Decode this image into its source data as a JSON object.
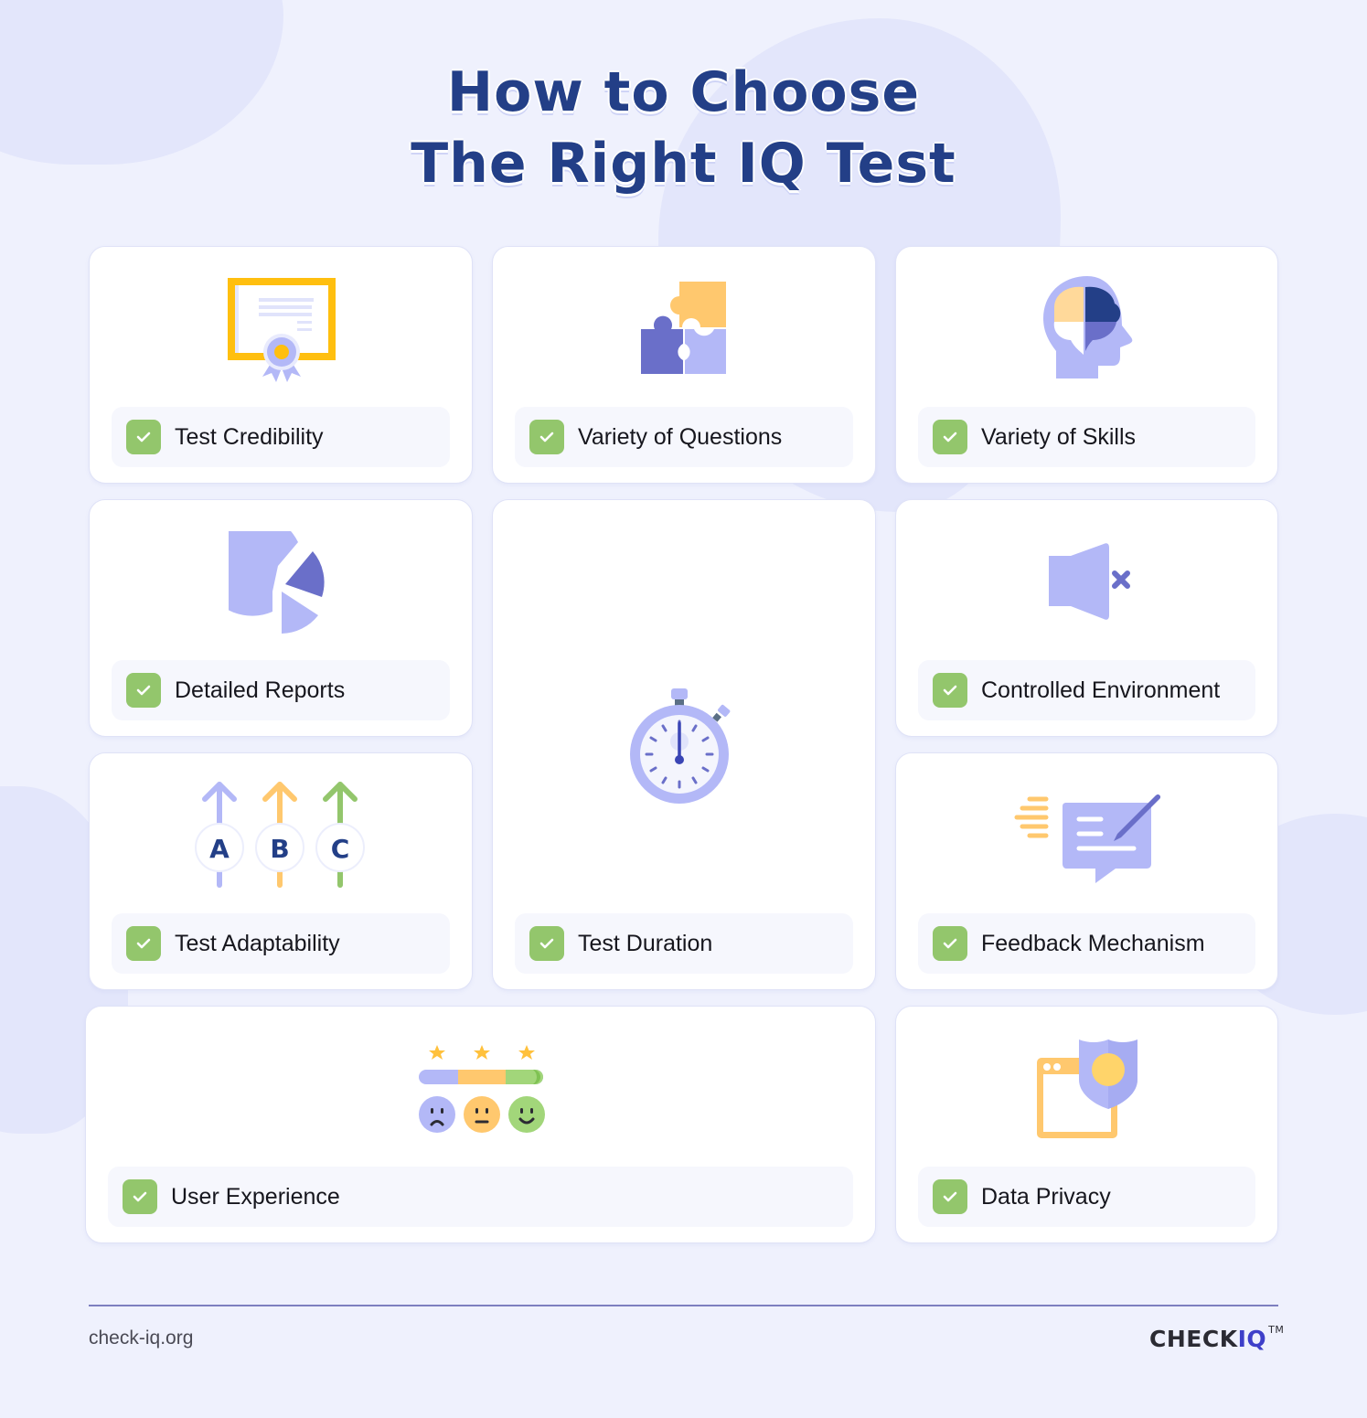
{
  "header": {
    "title_line1": "How to Choose",
    "title_line2": "The Right IQ Test"
  },
  "cards": [
    {
      "label": "Test Credibility",
      "icon": "certificate-icon"
    },
    {
      "label": "Variety of Questions",
      "icon": "puzzle-icon"
    },
    {
      "label": "Variety of Skills",
      "icon": "brain-head-icon"
    },
    {
      "label": "Detailed Reports",
      "icon": "pie-chart-icon"
    },
    {
      "label": "Test Duration",
      "icon": "stopwatch-icon"
    },
    {
      "label": "Controlled Environment",
      "icon": "muted-speaker-icon"
    },
    {
      "label": "Test Adaptability",
      "icon": "abc-arrows-icon",
      "letters": [
        "A",
        "B",
        "C"
      ]
    },
    {
      "label": "Feedback Mechanism",
      "icon": "feedback-message-icon"
    },
    {
      "label": "User Experience",
      "icon": "rating-faces-icon"
    },
    {
      "label": "Data Privacy",
      "icon": "shield-window-icon"
    }
  ],
  "footer": {
    "url": "check-iq.org",
    "brand_main": "CHECK",
    "brand_accent": "IQ",
    "trademark": "TM"
  },
  "colors": {
    "title": "#233f87",
    "check": "#93c66c",
    "lavender": "#b3b8f7",
    "indigo": "#6a6fc9",
    "yellow": "#ffc86e",
    "brand_accent": "#3e3fc9"
  }
}
